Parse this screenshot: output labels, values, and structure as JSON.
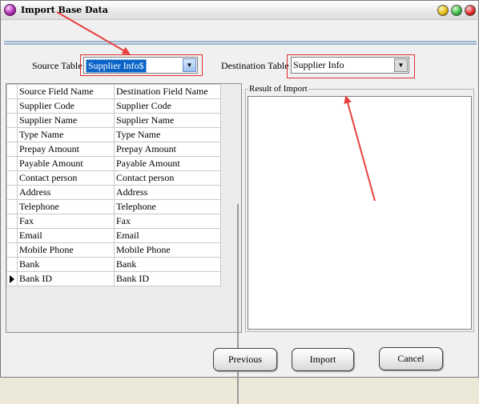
{
  "window": {
    "title": "Import  Base Data"
  },
  "source": {
    "label": "Source Table",
    "value": "Supplier Info$"
  },
  "destination": {
    "label": "Destination Table",
    "value": "Supplier Info"
  },
  "grid": {
    "headers": [
      "Source Field Name",
      "Destination Field Name"
    ],
    "rows": [
      [
        "Supplier Code",
        "Supplier Code"
      ],
      [
        "Supplier Name",
        "Supplier Name"
      ],
      [
        "Type Name",
        "Type Name"
      ],
      [
        "Prepay Amount",
        "Prepay Amount"
      ],
      [
        "Payable Amount",
        "Payable Amount"
      ],
      [
        "Contact person",
        "Contact person"
      ],
      [
        "Address",
        "Address"
      ],
      [
        "Telephone",
        "Telephone"
      ],
      [
        "Fax",
        "Fax"
      ],
      [
        "Email",
        "Email"
      ],
      [
        "Mobile Phone",
        "Mobile Phone"
      ],
      [
        "Bank",
        "Bank"
      ],
      [
        "Bank ID",
        "Bank ID"
      ]
    ],
    "current_row": 12
  },
  "result": {
    "label": "Result of Import"
  },
  "buttons": {
    "previous": "Previous",
    "import": "Import",
    "cancel": "Cancel"
  },
  "colors": {
    "annotation": "#e03030",
    "selection": "#0a64c8"
  },
  "icons": {
    "app": "app-icon",
    "minimize": "minimize-icon",
    "maximize": "maximize-icon",
    "close": "close-icon",
    "dropdown": "chevron-down-icon",
    "row_pointer": "current-row-icon"
  }
}
